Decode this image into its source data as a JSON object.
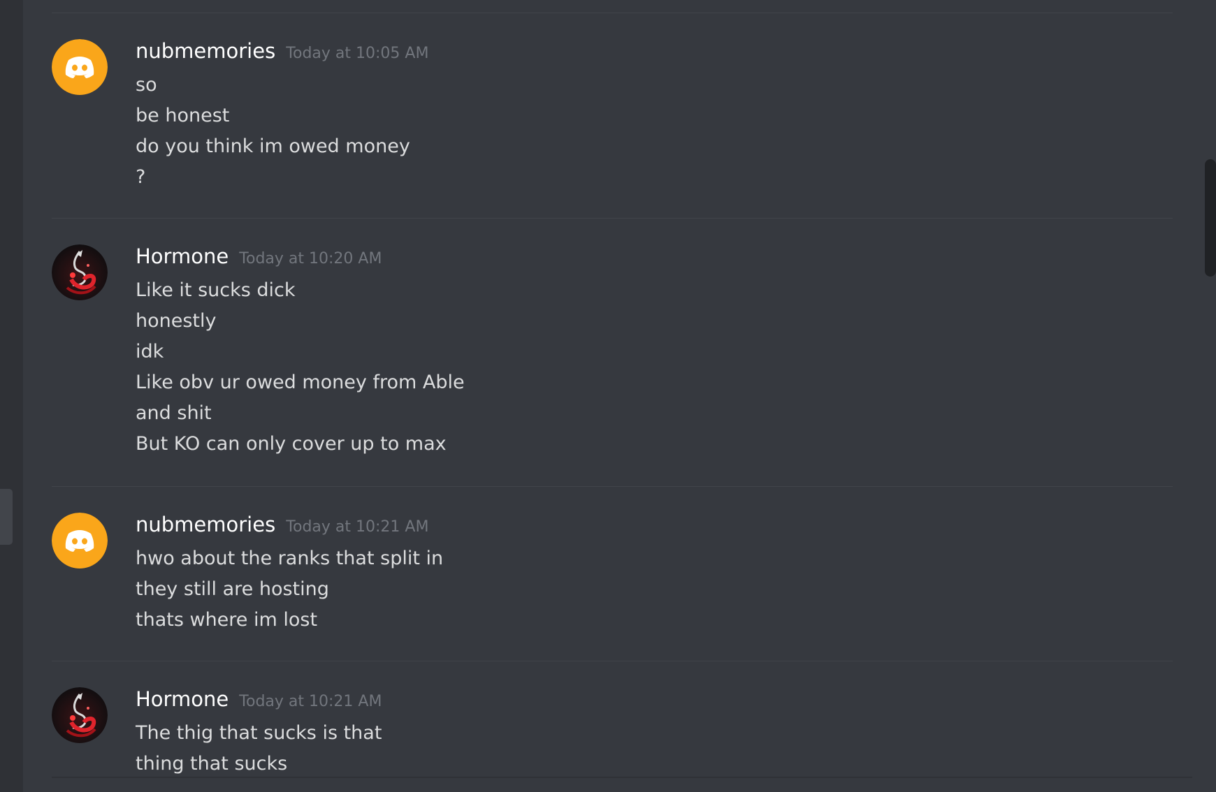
{
  "colors": {
    "background": "#36393f",
    "sidebar": "#2f3136",
    "username": "#ffffff",
    "timestamp": "#72767d",
    "message_text": "#dcddde",
    "discord_avatar": "#faa61a",
    "divider": "#41444a"
  },
  "messages": [
    {
      "username": "nubmemories",
      "timestamp": "Today at 10:05 AM",
      "avatar": "discord-default-avatar-icon",
      "lines": [
        "so",
        "be honest",
        "do you think im owed money",
        "?"
      ]
    },
    {
      "username": "Hormone",
      "timestamp": "Today at 10:20 AM",
      "avatar": "red-dragon-avatar",
      "lines": [
        "Like it sucks dick",
        "honestly",
        "idk",
        "Like obv ur owed money from Able",
        "and shit",
        "But KO can only cover up to max"
      ]
    },
    {
      "username": "nubmemories",
      "timestamp": "Today at 10:21 AM",
      "avatar": "discord-default-avatar-icon",
      "lines": [
        "hwo about the ranks that split in",
        "they still are hosting",
        "thats where im lost"
      ]
    },
    {
      "username": "Hormone",
      "timestamp": "Today at 10:21 AM",
      "avatar": "red-dragon-avatar",
      "lines": [
        "The thig that sucks is that",
        "thing that sucks"
      ]
    }
  ]
}
